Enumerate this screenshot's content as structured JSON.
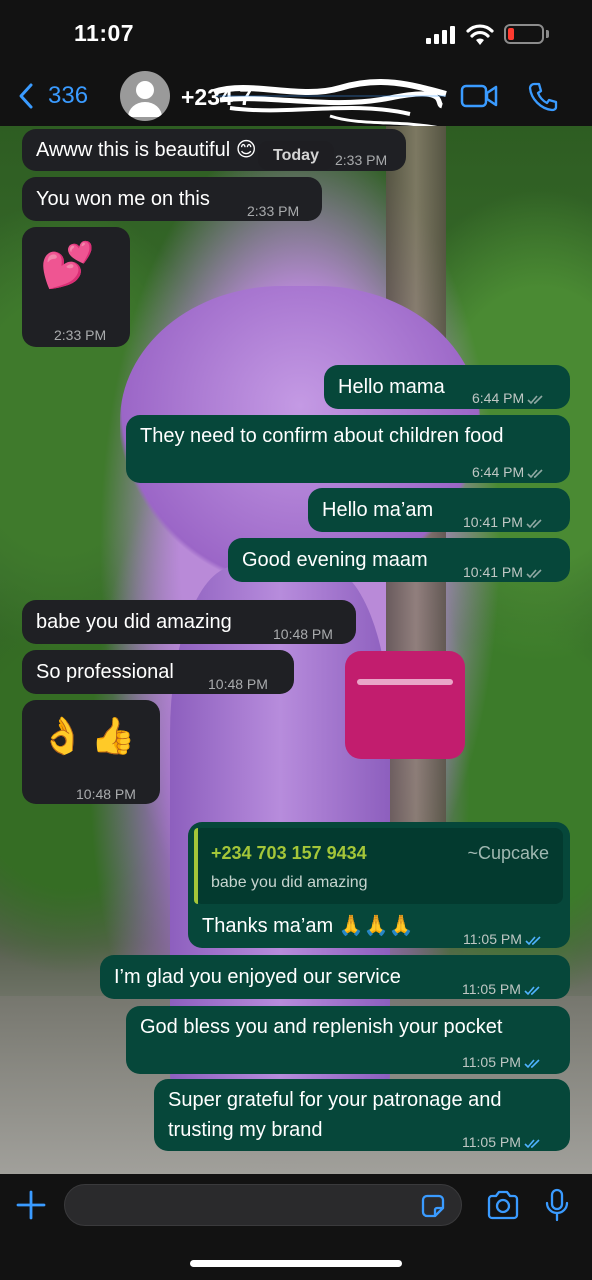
{
  "status_bar": {
    "time": "11:07"
  },
  "header": {
    "back_count": "336",
    "contact_name": "+234 7",
    "icons": [
      "chevron-left-icon",
      "avatar-icon",
      "video-call-icon",
      "phone-icon"
    ]
  },
  "chat": {
    "date_pill": "Today",
    "messages": [
      {
        "dir": "in",
        "text": "Awww this is beautiful 😊",
        "time": "2:33 PM"
      },
      {
        "dir": "in",
        "text": "You won me on this",
        "time": "2:33 PM"
      },
      {
        "dir": "in",
        "text": "💕",
        "time": "2:33 PM"
      },
      {
        "dir": "out",
        "text": "Hello mama",
        "time": "6:44 PM"
      },
      {
        "dir": "out",
        "text": "They need to confirm about children food",
        "time": "6:44 PM"
      },
      {
        "dir": "out",
        "text": "Hello ma’am",
        "time": "10:41 PM"
      },
      {
        "dir": "out",
        "text": "Good evening maam",
        "time": "10:41 PM"
      },
      {
        "dir": "in",
        "text": "babe you did amazing",
        "time": "10:48 PM"
      },
      {
        "dir": "in",
        "text": "So professional",
        "time": "10:48 PM"
      },
      {
        "dir": "in",
        "text": "👌👍",
        "time": "10:48 PM"
      },
      {
        "dir": "out",
        "text": "Thanks ma’am 🙏🙏🙏",
        "time": "11:05 PM",
        "quote": {
          "number": "+234 703 157 9434",
          "alias": "~Cupcake",
          "text": "babe you did amazing"
        }
      },
      {
        "dir": "out",
        "text": "I’m glad you enjoyed our service",
        "time": "11:05 PM"
      },
      {
        "dir": "out",
        "text": "God bless you and replenish your pocket",
        "time": "11:05 PM"
      },
      {
        "dir": "out",
        "text_line1": "Super grateful for your patronage and",
        "text_line2": "trusting my brand",
        "time": "11:05 PM"
      }
    ]
  },
  "input_bar": {
    "icons": [
      "plus-icon",
      "sticker-icon",
      "camera-icon",
      "microphone-icon"
    ]
  },
  "colors": {
    "accent_blue": "#3a9bff",
    "outgoing_bubble": "#06473a",
    "incoming_bubble": "#1f2024",
    "quote_green": "#a4c639",
    "battery_low": "#ff3b30"
  }
}
